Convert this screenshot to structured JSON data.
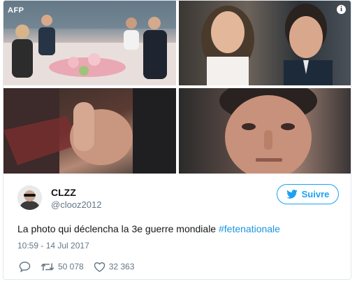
{
  "media": {
    "agency_watermark": "AFP",
    "info_icon": "i",
    "tiles": [
      {
        "description_icon": "photo-dinner"
      },
      {
        "description_icon": "photo-closeup"
      },
      {
        "description_icon": "photo-hand"
      },
      {
        "description_icon": "photo-face"
      }
    ]
  },
  "author": {
    "name": "CLZZ",
    "handle": "@clooz2012"
  },
  "follow": {
    "label": "Suivre",
    "icon": "bird-icon"
  },
  "tweet": {
    "text": "La photo qui déclencha la 3e guerre mondiale ",
    "hashtag": "#fetenationale",
    "timestamp": "10:59 - 14 Jul 2017"
  },
  "stats": {
    "retweets": "50 078",
    "likes": "32 363"
  },
  "colors": {
    "accent": "#1da1f2",
    "hashtag": "#1b95e0",
    "muted": "#657786",
    "text": "#14171a",
    "border": "#e1e8ed"
  }
}
